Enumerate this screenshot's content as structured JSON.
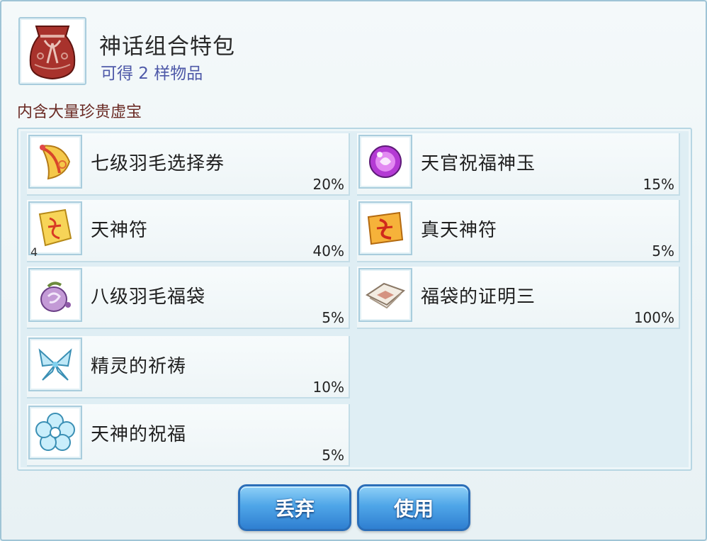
{
  "header": {
    "title": "神话组合特包",
    "subtitle": "可得 2 样物品",
    "icon": "red-pouch-icon"
  },
  "description": "内含大量珍贵虚宝",
  "items": [
    {
      "name": "七级羽毛选择券",
      "percent": "20%",
      "icon": "feather-ticket-icon",
      "qty": ""
    },
    {
      "name": "天官祝福神玉",
      "percent": "15%",
      "icon": "purple-orb-icon",
      "qty": ""
    },
    {
      "name": "天神符",
      "percent": "40%",
      "icon": "golden-talisman-icon",
      "qty": "4"
    },
    {
      "name": "真天神符",
      "percent": "5%",
      "icon": "true-talisman-icon",
      "qty": ""
    },
    {
      "name": "八级羽毛福袋",
      "percent": "5%",
      "icon": "purple-bag-icon",
      "qty": ""
    },
    {
      "name": "福袋的证明三",
      "percent": "100%",
      "icon": "certificate-icon",
      "qty": ""
    },
    {
      "name": "精灵的祈祷",
      "percent": "10%",
      "icon": "crystal-butterfly-icon",
      "qty": ""
    },
    {
      "name": "天神的祝福",
      "percent": "5%",
      "icon": "crystal-flower-icon",
      "qty": ""
    }
  ],
  "buttons": {
    "discard": "丢弃",
    "use": "使用"
  },
  "colors": {
    "subtitle": "#4e59a8",
    "description": "#6a2a24",
    "button": "#4fa6e8",
    "panel_border": "#a9cddd"
  }
}
